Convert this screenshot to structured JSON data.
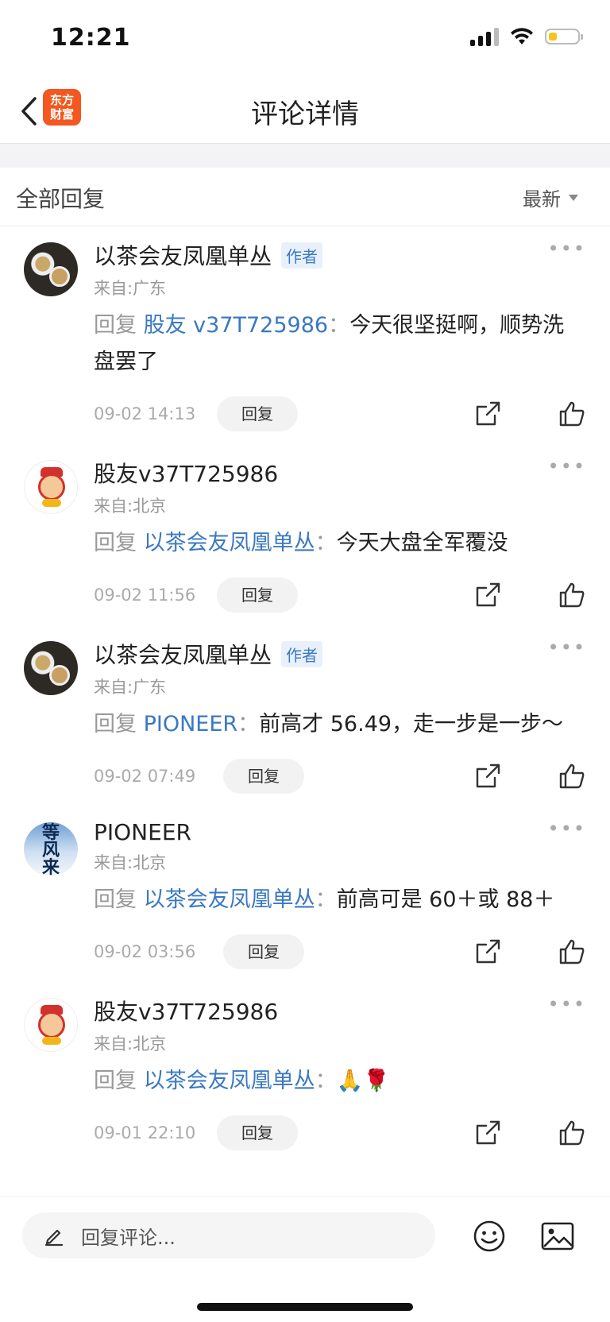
{
  "status_bar": {
    "time": "12:21",
    "battery_level": 0.3
  },
  "nav": {
    "title": "评论详情",
    "logo_line1": "东方",
    "logo_line2": "财富"
  },
  "sort": {
    "title": "全部回复",
    "selected": "最新"
  },
  "comments": [
    {
      "name": "以茶会友凤凰单丛",
      "is_author": true,
      "author_tag": "作者",
      "avatar": "tea-avatar",
      "location": "来自:广东",
      "reply_prefix": "回复",
      "mention": "股友 v37T725986",
      "colon": "：",
      "text": "今天很坚挺啊，顺势洗盘罢了",
      "date": "09-02 14:13",
      "reply_label": "回复"
    },
    {
      "name": "股友v37T725986",
      "is_author": false,
      "author_tag": "",
      "avatar": "god-of-wealth-avatar",
      "location": "来自:北京",
      "reply_prefix": "回复",
      "mention": "以茶会友凤凰单丛",
      "colon": "：",
      "text": "今天大盘全军覆没",
      "date": "09-02 11:56",
      "reply_label": "回复"
    },
    {
      "name": "以茶会友凤凰单丛",
      "is_author": true,
      "author_tag": "作者",
      "avatar": "tea-avatar",
      "location": "来自:广东",
      "reply_prefix": "回复",
      "mention": "PIONEER",
      "colon": "：",
      "text": "前高才 56.49，走一步是一步～",
      "date": "09-02 07:49",
      "reply_label": "回复"
    },
    {
      "name": "PIONEER",
      "is_author": false,
      "author_tag": "",
      "avatar": "wind-calligraphy-avatar",
      "location": "来自:北京",
      "reply_prefix": "回复",
      "mention": "以茶会友凤凰单丛",
      "colon": "：",
      "text": "前高可是 60＋或 88＋",
      "date": "09-02 03:56",
      "reply_label": "回复"
    },
    {
      "name": "股友v37T725986",
      "is_author": false,
      "author_tag": "",
      "avatar": "god-of-wealth-avatar",
      "location": "来自:北京",
      "reply_prefix": "回复",
      "mention": "以茶会友凤凰单丛",
      "colon": "：",
      "text": "🙏🌹",
      "date": "09-01 22:10",
      "reply_label": "回复"
    }
  ],
  "bottom": {
    "placeholder": "回复评论..."
  },
  "wind_avatar_text": [
    "等",
    "风",
    "来"
  ]
}
